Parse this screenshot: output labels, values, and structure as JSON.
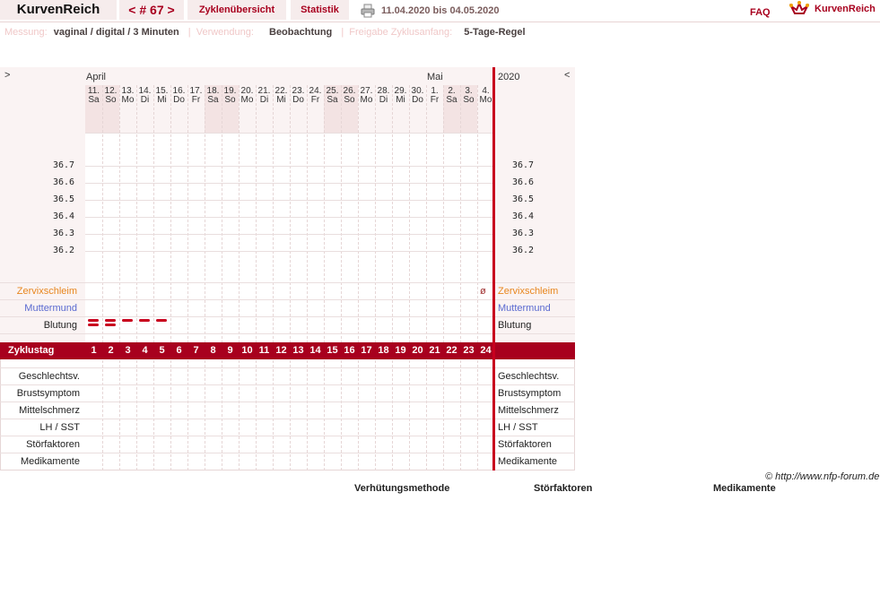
{
  "header": {
    "brand": "KurvenReich",
    "cycle": "< # 67 >",
    "overview": "Zyklenübersicht",
    "stats": "Statistik",
    "date_range": "11.04.2020 bis 04.05.2020",
    "faq": "FAQ",
    "logo_text": "KurvenReich"
  },
  "settings": {
    "messung_label": "Messung:",
    "messung_value": "vaginal / digital / 3 Minuten",
    "verwendung_label": "Verwendung:",
    "verwendung_value": "Beobachtung",
    "freigabe_label": "Freigabe Zyklusanfang:",
    "freigabe_value": "5-Tage-Regel"
  },
  "chart": {
    "nav_prev": ">",
    "nav_next": "<",
    "month_april": "April",
    "month_may": "Mai",
    "year": "2020",
    "days": [
      {
        "d": "11.",
        "w": "Sa"
      },
      {
        "d": "12.",
        "w": "So"
      },
      {
        "d": "13.",
        "w": "Mo"
      },
      {
        "d": "14.",
        "w": "Di"
      },
      {
        "d": "15.",
        "w": "Mi"
      },
      {
        "d": "16.",
        "w": "Do"
      },
      {
        "d": "17.",
        "w": "Fr"
      },
      {
        "d": "18.",
        "w": "Sa"
      },
      {
        "d": "19.",
        "w": "So"
      },
      {
        "d": "20.",
        "w": "Mo"
      },
      {
        "d": "21.",
        "w": "Di"
      },
      {
        "d": "22.",
        "w": "Mi"
      },
      {
        "d": "23.",
        "w": "Do"
      },
      {
        "d": "24.",
        "w": "Fr"
      },
      {
        "d": "25.",
        "w": "Sa"
      },
      {
        "d": "26.",
        "w": "So"
      },
      {
        "d": "27.",
        "w": "Mo"
      },
      {
        "d": "28.",
        "w": "Di"
      },
      {
        "d": "29.",
        "w": "Mi"
      },
      {
        "d": "30.",
        "w": "Do"
      },
      {
        "d": "1.",
        "w": "Fr"
      },
      {
        "d": "2.",
        "w": "Sa"
      },
      {
        "d": "3.",
        "w": "So"
      },
      {
        "d": "4.",
        "w": "Mo"
      }
    ],
    "weekend_color": "#f3e3e3",
    "temps": [
      "36.7",
      "36.6",
      "36.5",
      "36.4",
      "36.3",
      "36.2"
    ],
    "zervix_label": "Zervixschleim",
    "zervix_color": "#e8861e",
    "zervix_mark": "ø",
    "muttermund_label": "Muttermund",
    "muttermund_color": "#5a6ad0",
    "blutung_label": "Blutung",
    "zyklustag_label": "Zyklustag",
    "cycle_days": [
      "1",
      "2",
      "3",
      "4",
      "5",
      "6",
      "7",
      "8",
      "9",
      "10",
      "11",
      "12",
      "13",
      "14",
      "15",
      "16",
      "17",
      "18",
      "19",
      "20",
      "21",
      "22",
      "23",
      "24"
    ],
    "bleeding": [
      2,
      2,
      1,
      1,
      1
    ],
    "bottom_rows": [
      "Geschlechtsv.",
      "Brustsymptom",
      "Mittelschmerz",
      "LH / SST",
      "Störfaktoren",
      "Medikamente"
    ],
    "copyright": "© http://www.nfp-forum.de",
    "accent": "#a8001e"
  },
  "footer": {
    "verhuetung": "Verhütungsmethode",
    "stoerfaktoren": "Störfaktoren",
    "medikamente": "Medikamente"
  }
}
